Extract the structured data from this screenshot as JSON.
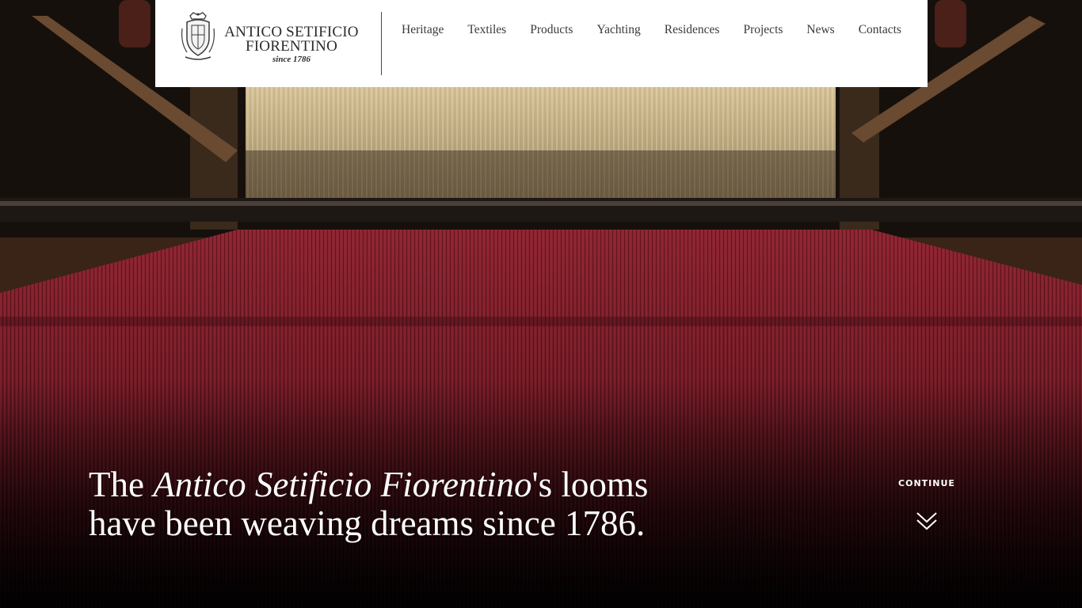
{
  "brand": {
    "line1": "ANTICO SETIFICIO",
    "line2": "FIORENTINO",
    "since": "since 1786"
  },
  "nav": {
    "items": [
      {
        "label": "Heritage"
      },
      {
        "label": "Textiles"
      },
      {
        "label": "Products"
      },
      {
        "label": "Yachting"
      },
      {
        "label": "Residences"
      },
      {
        "label": "Projects"
      },
      {
        "label": "News"
      },
      {
        "label": "Contacts"
      }
    ]
  },
  "hero": {
    "headline_before": "The ",
    "headline_brand": "Antico Setificio Fiorentino",
    "headline_after_line1": "'s looms",
    "headline_line2": "have been weaving dreams since 1786."
  },
  "continue": {
    "label": "CONTINUE",
    "icon": "double-chevron-down-icon"
  },
  "colors": {
    "header_bg": "#ffffff",
    "nav_text": "#3a3a3a",
    "warp_red": "#7a1a26",
    "hero_text": "#ffffff"
  }
}
